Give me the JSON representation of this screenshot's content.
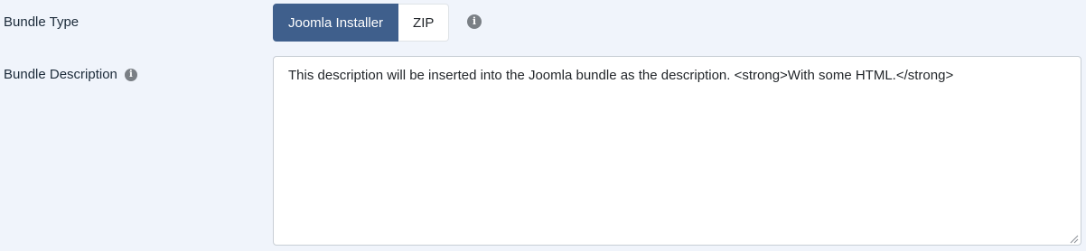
{
  "bundle_type": {
    "label": "Bundle Type",
    "options": [
      {
        "label": "Joomla Installer",
        "selected": true
      },
      {
        "label": "ZIP",
        "selected": false
      }
    ],
    "info_icon": "info-icon"
  },
  "bundle_description": {
    "label": "Bundle Description",
    "info_icon": "info-icon",
    "value": "This description will be inserted into the Joomla bundle as the description. <strong>With some HTML.</strong>"
  },
  "colors": {
    "active_button": "#3f5f8c",
    "page_background": "#f0f4fb",
    "info_icon": "#7a7f85"
  }
}
